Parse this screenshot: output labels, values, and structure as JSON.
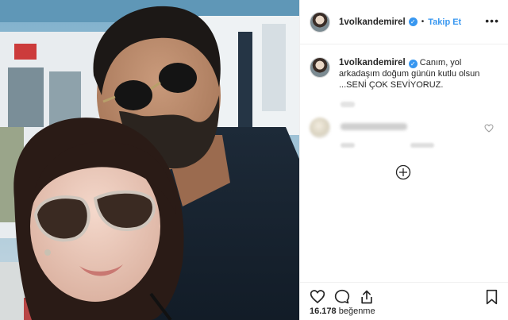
{
  "post": {
    "author": "1volkandemirel",
    "follow_label": "Takip Et",
    "more_label": "•••",
    "caption_line1": "Canım, yol",
    "caption_line2": "arkadaşım doğum günün kutlu olsun",
    "caption_line3": "...SENİ ÇOK SEVİYORUZ.",
    "likes_count": "16.178",
    "likes_label": "beğenme"
  },
  "icons": {
    "verified": "verified-badge-icon",
    "like": "heart-icon",
    "comment": "comment-icon",
    "share": "share-icon",
    "save": "bookmark-icon",
    "load_more": "plus-circle-icon"
  },
  "colors": {
    "link_blue": "#3897f0",
    "text": "#262626",
    "border": "#efefef"
  }
}
